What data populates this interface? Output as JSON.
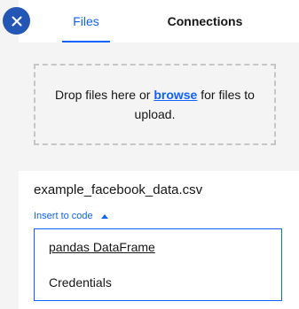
{
  "tabs": [
    {
      "label": "Files"
    },
    {
      "label": "Connections"
    }
  ],
  "upload": {
    "text_before": "Drop files here or ",
    "browse_link": "browse",
    "text_after": " for files to upload."
  },
  "file": {
    "name": "example_facebook_data.csv",
    "insert_label": "Insert to code"
  },
  "insert_menu": {
    "items": [
      {
        "label": "pandas DataFrame"
      },
      {
        "label": "Credentials"
      }
    ]
  },
  "colors": {
    "accent": "#0f62fe",
    "close_button": "#2457b5"
  },
  "icons": {
    "close": "close-icon",
    "caret": "caret-up-icon"
  }
}
